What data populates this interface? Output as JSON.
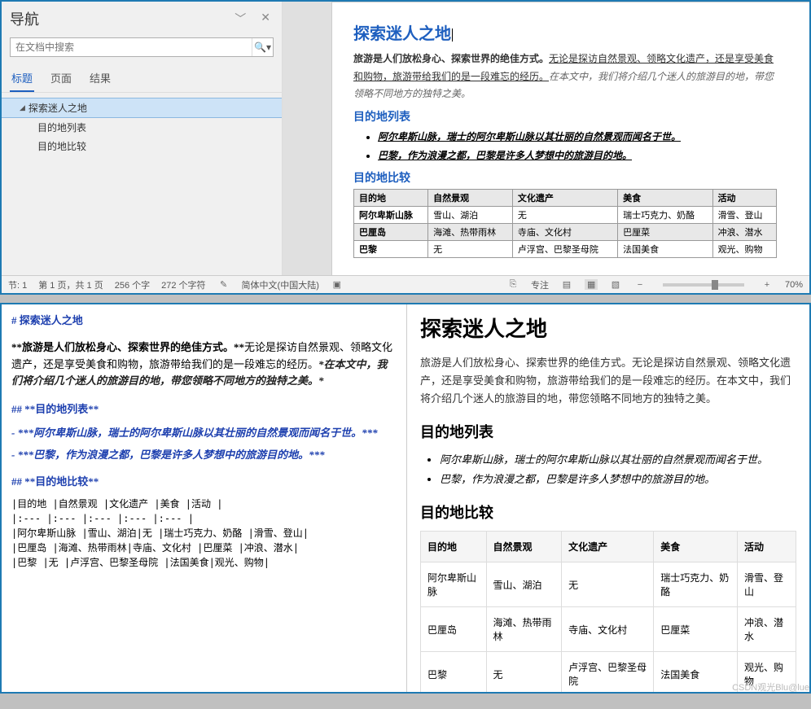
{
  "nav": {
    "title": "导航",
    "search_placeholder": "在文档中搜索",
    "tabs": [
      "标题",
      "页面",
      "结果"
    ],
    "tree": {
      "root": "探索迷人之地",
      "children": [
        "目的地列表",
        "目的地比较"
      ]
    }
  },
  "doc": {
    "h1": "探索迷人之地",
    "p1_bold": "旅游是人们放松身心、探索世界的绝佳方式。",
    "p1_ul": "无论是探访自然景观、领略文化遗产，还是享受美食和购物，旅游带给我们的是一段难忘的经历。",
    "p1_it": "在本文中，我们将介绍几个迷人的旅游目的地，带您领略不同地方的独特之美。",
    "h2a": "目的地列表",
    "li1": "阿尔卑斯山脉，瑞士的阿尔卑斯山脉以其壮丽的自然景观而闻名于世。",
    "li2": "巴黎，作为浪漫之都，巴黎是许多人梦想中的旅游目的地。",
    "h2b": "目的地比较",
    "table": {
      "headers": [
        "目的地",
        "自然景观",
        "文化遗产",
        "美食",
        "活动"
      ],
      "rows": [
        [
          "阿尔卑斯山脉",
          "雪山、湖泊",
          "无",
          "瑞士巧克力、奶酪",
          "滑雪、登山"
        ],
        [
          "巴厘岛",
          "海滩、热带雨林",
          "寺庙、文化村",
          "巴厘菜",
          "冲浪、潜水"
        ],
        [
          "巴黎",
          "无",
          "卢浮宫、巴黎圣母院",
          "法国美食",
          "观光、购物"
        ]
      ]
    }
  },
  "status": {
    "sec": "节: 1",
    "page": "第 1 页，共 1 页",
    "words": "256 个字",
    "chars": "272 个字符",
    "lang": "简体中文(中国大陆)",
    "focus": "专注",
    "zoom": "70%",
    "plus": "+"
  },
  "md": {
    "h1": "# 探索迷人之地",
    "p_b": "**旅游是人们放松身心、探索世界的绝佳方式。**",
    "p_u": "无论是探访自然景观、领略文化遗产，还是享受美食和购物，旅游带给我们的是一段难忘的经历。",
    "p_it": "*在本文中，我们将介绍几个迷人的旅游目的地，带您领略不同地方的独特之美。*",
    "h2a": "## **目的地列表**",
    "list1": "- ***阿尔卑斯山脉，瑞士的阿尔卑斯山脉以其壮丽的自然景观而闻名于世。***",
    "list2": "- ***巴黎，作为浪漫之都，巴黎是许多人梦想中的旅游目的地。***",
    "h2b": "## **目的地比较**",
    "table_raw": "|目的地 |自然景观 |文化遗产 |美食 |活动 |\n|:--- |:--- |:--- |:--- |:--- |\n|阿尔卑斯山脉 |雪山、湖泊|无 |瑞士巧克力、奶酪 |滑雪、登山|\n|巴厘岛 |海滩、热带雨林|寺庙、文化村 |巴厘菜 |冲浪、潜水|\n|巴黎 |无 |卢浮宫、巴黎圣母院 |法国美食|观光、购物|"
  },
  "render": {
    "h1": "探索迷人之地",
    "p": "旅游是人们放松身心、探索世界的绝佳方式。无论是探访自然景观、领略文化遗产，还是享受美食和购物，旅游带给我们的是一段难忘的经历。在本文中，我们将介绍几个迷人的旅游目的地，带您领略不同地方的独特之美。",
    "h2a": "目的地列表",
    "li1": "阿尔卑斯山脉，瑞士的阿尔卑斯山脉以其壮丽的自然景观而闻名于世。",
    "li2": "巴黎，作为浪漫之都，巴黎是许多人梦想中的旅游目的地。",
    "h2b": "目的地比较",
    "table": {
      "headers": [
        "目的地",
        "自然景观",
        "文化遗产",
        "美食",
        "活动"
      ],
      "rows": [
        [
          "阿尔卑斯山脉",
          "雪山、湖泊",
          "无",
          "瑞士巧克力、奶酪",
          "滑雪、登山"
        ],
        [
          "巴厘岛",
          "海滩、热带雨林",
          "寺庙、文化村",
          "巴厘菜",
          "冲浪、潜水"
        ],
        [
          "巴黎",
          "无",
          "卢浮宫、巴黎圣母院",
          "法国美食",
          "观光、购物"
        ]
      ]
    },
    "watermark": "CSDN观光Blu@lue"
  }
}
